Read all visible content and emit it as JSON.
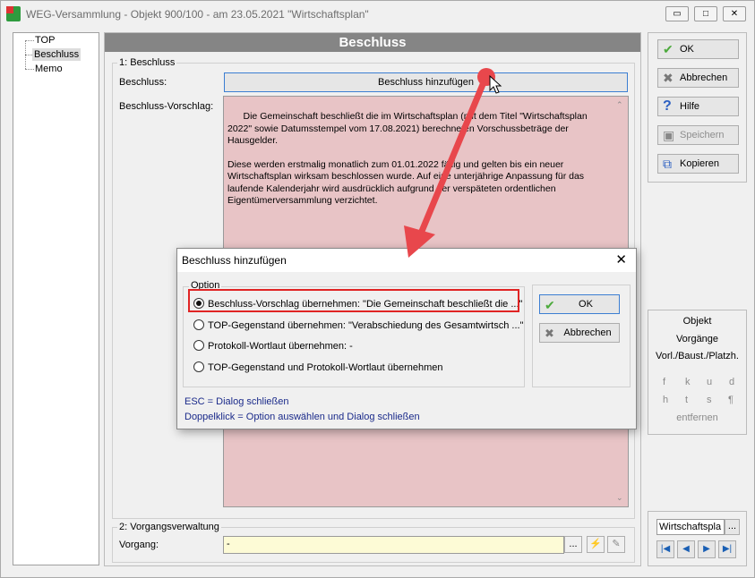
{
  "window": {
    "title": "WEG-Versammlung - Objekt 900/100 - am 23.05.2021 \"Wirtschaftsplan\"",
    "minimize": "▭",
    "maximize": "□",
    "close": "✕"
  },
  "tree": {
    "items": [
      "TOP",
      "Beschluss",
      "Memo"
    ],
    "selected": "Beschluss"
  },
  "main": {
    "header": "Beschluss",
    "section1_title": "1: Beschluss",
    "beschluss_label": "Beschluss:",
    "add_button": "Beschluss hinzufügen",
    "vorschlag_label": "Beschluss-Vorschlag:",
    "vorschlag_text": "Die Gemeinschaft beschließt die im Wirtschaftsplan (mit dem Titel \"Wirtschaftsplan 2022\" sowie Datumsstempel vom 17.08.2021) berechneten Vorschussbeträge der Hausgelder.\n\nDiese werden erstmalig monatlich zum 01.01.2022 fällig und gelten bis ein neuer Wirtschaftsplan wirksam beschlossen wurde. Auf eine unterjährige Anpassung für das laufende Kalenderjahr wird ausdrücklich aufgrund der verspäteten ordentlichen Eigentümerversammlung verzichtet.",
    "section2_title": "2: Vorgangsverwaltung",
    "vorgang_label": "Vorgang:",
    "vorgang_value": "-",
    "dots": "..."
  },
  "actions": {
    "ok": "OK",
    "cancel": "Abbrechen",
    "help": "Hilfe",
    "save": "Speichern",
    "copy": "Kopieren"
  },
  "info": {
    "objekt": "Objekt",
    "vorgaenge": "Vorgänge",
    "vorl": "Vorl./Baust./Platzh.",
    "glyphs_row1": [
      "f",
      "k",
      "u",
      "d"
    ],
    "glyphs_row2": [
      "h",
      "t",
      "s",
      "¶"
    ],
    "entfernen": "entfernen"
  },
  "nav": {
    "value": "Wirtschaftspla",
    "dots": "..."
  },
  "dialog": {
    "title": "Beschluss hinzufügen",
    "group_title": "Option",
    "options": [
      {
        "label": "Beschluss-Vorschlag übernehmen: \"Die Gemeinschaft beschließt die  ...\"",
        "selected": true
      },
      {
        "label": "TOP-Gegenstand übernehmen: \"Verabschiedung des Gesamtwirtsch ...\"",
        "selected": false
      },
      {
        "label": "Protokoll-Wortlaut übernehmen: -",
        "selected": false
      },
      {
        "label": "TOP-Gegenstand und Protokoll-Wortlaut übernehmen",
        "selected": false
      }
    ],
    "ok": "OK",
    "cancel": "Abbrechen",
    "hint1": "ESC = Dialog schließen",
    "hint2": "Doppelklick = Option auswählen und Dialog schließen"
  },
  "colors": {
    "header_bg": "#858585",
    "textarea_bg": "#e8c4c6",
    "input_yellow": "#fdfbd6",
    "highlight": "#e02424",
    "arrow": "#e8474c"
  }
}
